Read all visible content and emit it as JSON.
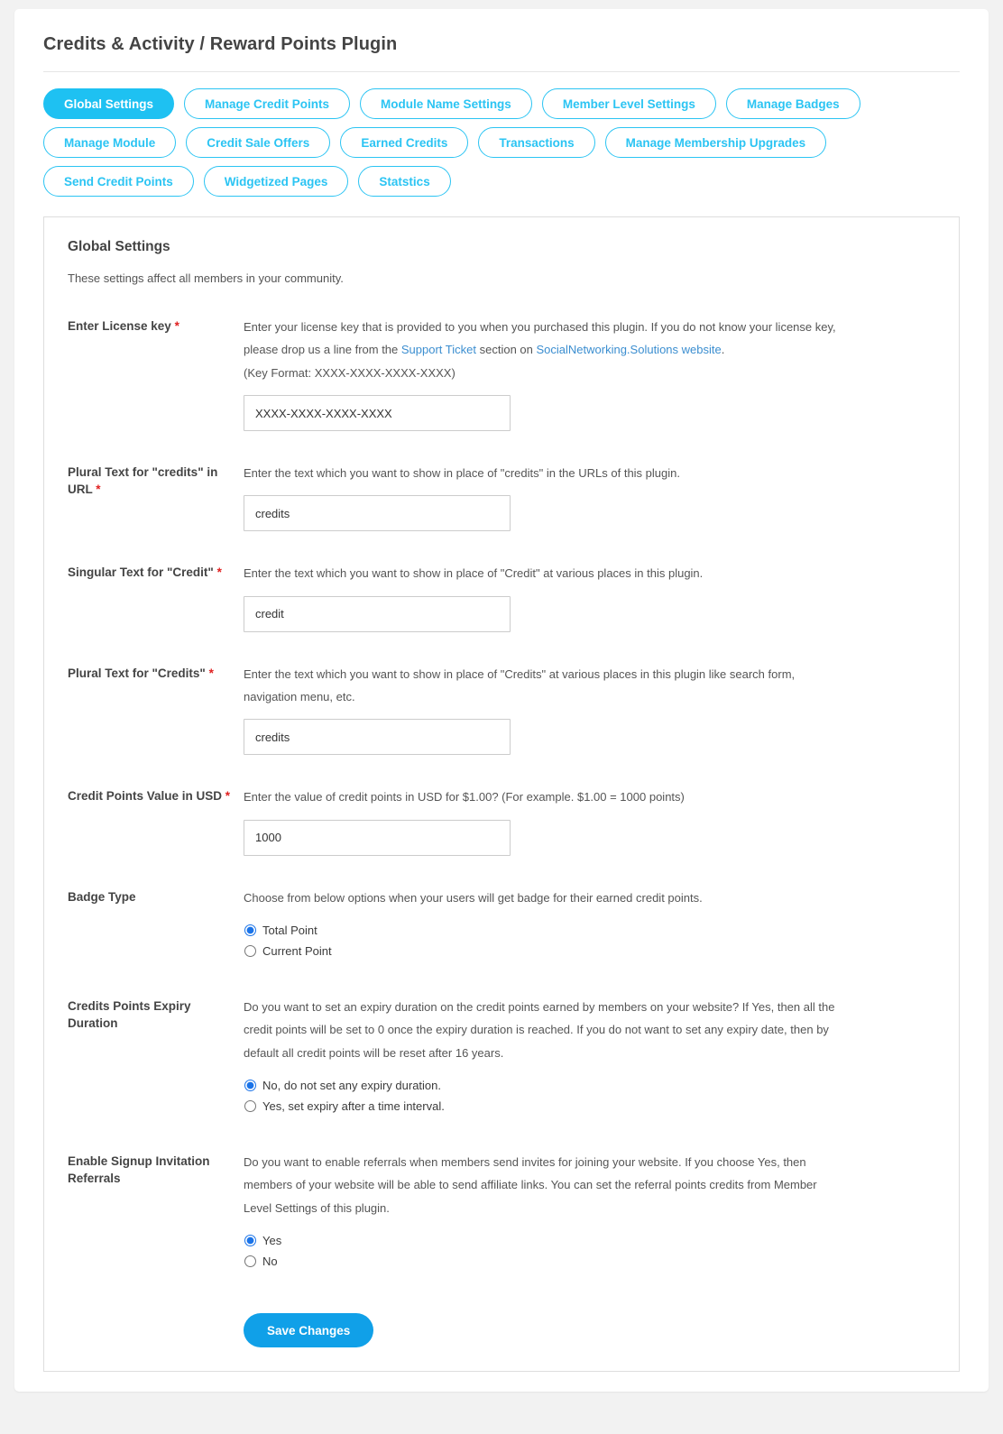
{
  "header": {
    "title": "Credits & Activity / Reward Points Plugin"
  },
  "tabs": [
    {
      "label": "Global Settings",
      "active": true
    },
    {
      "label": "Manage Credit Points",
      "active": false
    },
    {
      "label": "Module Name Settings",
      "active": false
    },
    {
      "label": "Member Level Settings",
      "active": false
    },
    {
      "label": "Manage Badges",
      "active": false
    },
    {
      "label": "Manage Module",
      "active": false
    },
    {
      "label": "Credit Sale Offers",
      "active": false
    },
    {
      "label": "Earned Credits",
      "active": false
    },
    {
      "label": "Transactions",
      "active": false
    },
    {
      "label": "Manage Membership Upgrades",
      "active": false
    },
    {
      "label": "Send Credit Points",
      "active": false
    },
    {
      "label": "Widgetized Pages",
      "active": false
    },
    {
      "label": "Statstics",
      "active": false
    }
  ],
  "section": {
    "title": "Global Settings",
    "subtitle": "These settings affect all members in your community."
  },
  "fields": {
    "license": {
      "label": "Enter License key",
      "required": "*",
      "desc_part1": "Enter your license key that is provided to you when you purchased this plugin. If you do not know your license key, please drop us a line from the ",
      "link1": "Support Ticket",
      "desc_part2": " section on ",
      "link2": "SocialNetworking.Solutions website",
      "desc_part3": ".",
      "key_format": "(Key Format: XXXX-XXXX-XXXX-XXXX)",
      "value": "XXXX-XXXX-XXXX-XXXX"
    },
    "plural_url": {
      "label": "Plural Text for \"credits\" in URL",
      "required": "*",
      "desc": "Enter the text which you want to show in place of \"credits\" in the URLs of this plugin.",
      "value": "credits"
    },
    "singular_credit": {
      "label": "Singular Text for \"Credit\"",
      "required": "*",
      "desc": "Enter the text which you want to show in place of \"Credit\" at various places in this plugin.",
      "value": "credit"
    },
    "plural_credits": {
      "label": "Plural Text for \"Credits\"",
      "required": "*",
      "desc": "Enter the text which you want to show in place of \"Credits\" at various places in this plugin like search form, navigation menu, etc.",
      "value": "credits"
    },
    "credit_value_usd": {
      "label": "Credit Points Value in USD",
      "required": "*",
      "desc": "Enter the value of credit points in USD for $1.00? (For example. $1.00 = 1000 points)",
      "value": "1000"
    },
    "badge_type": {
      "label": "Badge Type",
      "required": "",
      "desc": "Choose from below options when your users will get badge for their earned credit points.",
      "options": [
        {
          "label": "Total Point",
          "selected": true
        },
        {
          "label": "Current Point",
          "selected": false
        }
      ]
    },
    "expiry_duration": {
      "label": "Credits Points Expiry Duration",
      "required": "",
      "desc": "Do you want to set an expiry duration on the credit points earned by members on your website? If Yes, then all the credit points will be set to 0 once the expiry duration is reached. If you do not want to set any expiry date, then by default all credit points will be reset after 16 years.",
      "options": [
        {
          "label": "No, do not set any expiry duration.",
          "selected": true
        },
        {
          "label": "Yes, set expiry after a time interval.",
          "selected": false
        }
      ]
    },
    "signup_referrals": {
      "label": "Enable Signup Invitation Referrals",
      "required": "",
      "desc": "Do you want to enable referrals when members send invites for joining your website. If you choose Yes, then members of your website will be able to send affiliate links. You can set the referral points credits from Member Level Settings of this plugin.",
      "options": [
        {
          "label": "Yes",
          "selected": true
        },
        {
          "label": "No",
          "selected": false
        }
      ]
    }
  },
  "actions": {
    "save_label": "Save Changes"
  },
  "colors": {
    "accent": "#1ec1f2",
    "accent_button": "#10a0e8",
    "link": "#3b8ed0",
    "required": "#e02020",
    "text": "#444444",
    "page_bg": "#f2f2f2"
  }
}
